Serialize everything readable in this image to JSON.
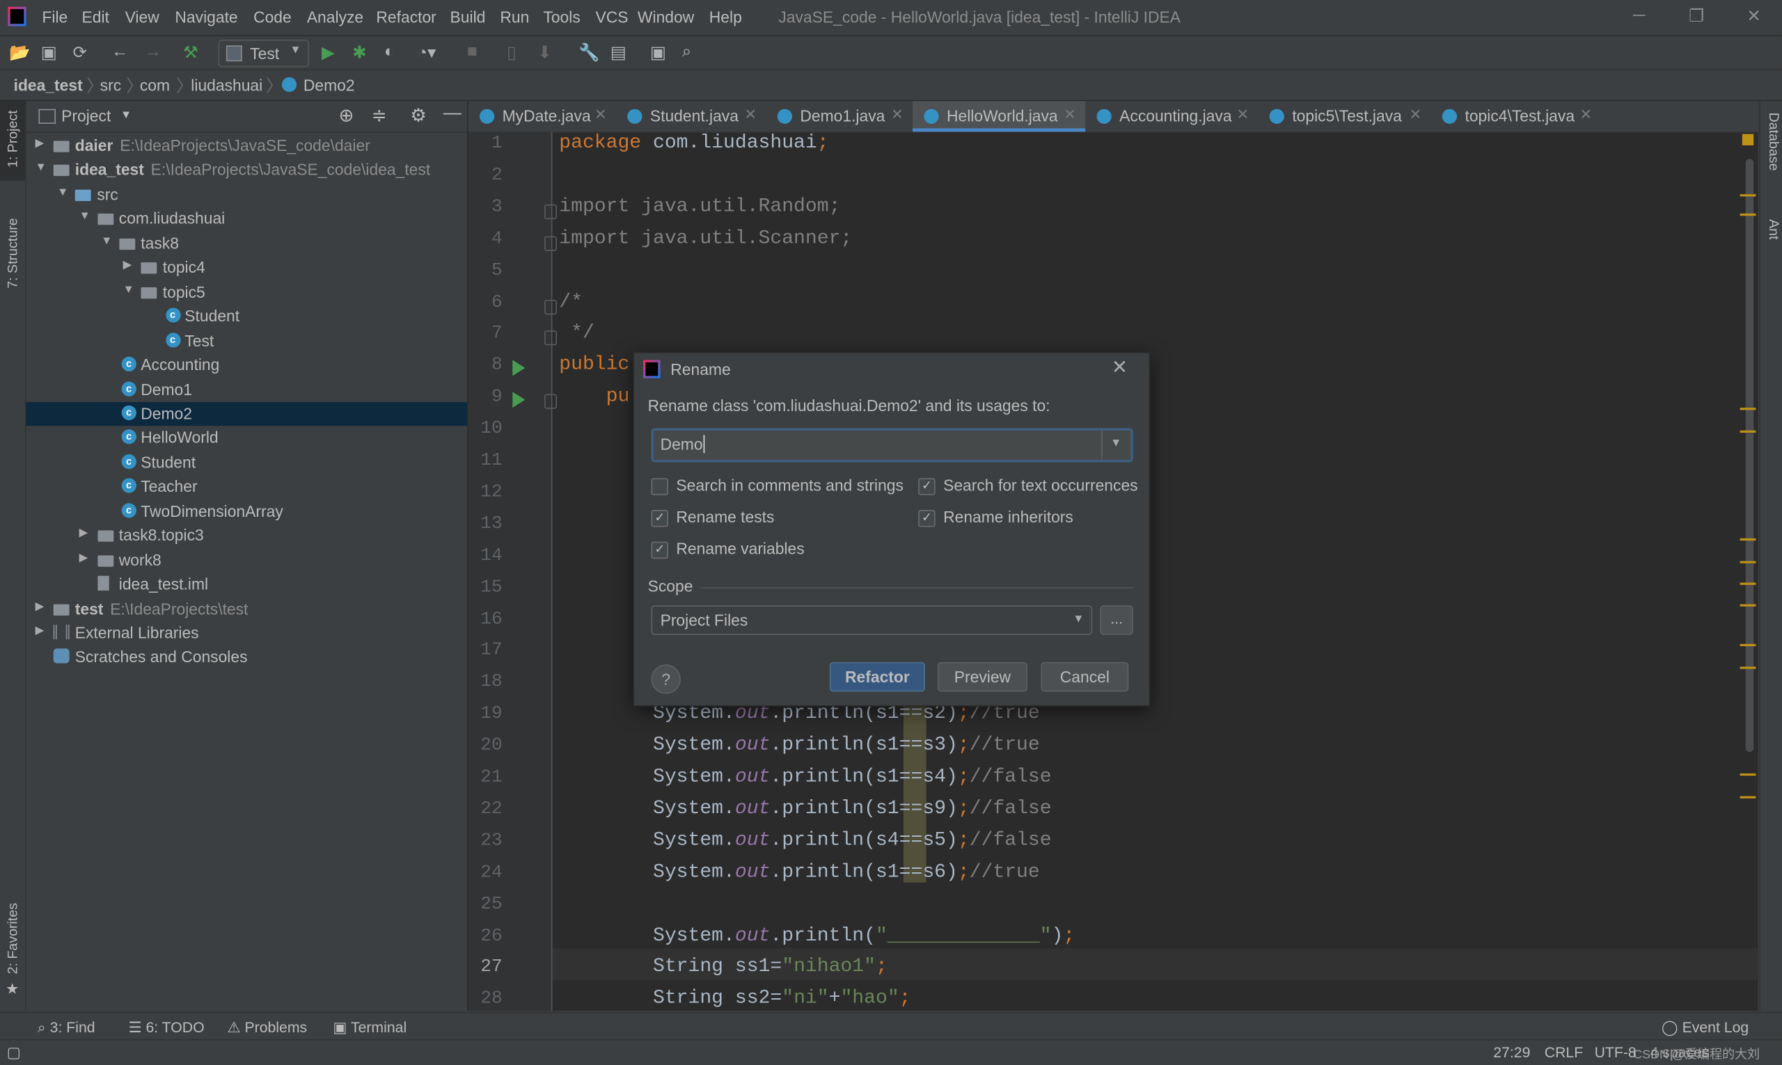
{
  "window": {
    "title": "JavaSE_code - HelloWorld.java [idea_test] - IntelliJ IDEA",
    "menu": [
      "File",
      "Edit",
      "View",
      "Navigate",
      "Code",
      "Analyze",
      "Refactor",
      "Build",
      "Run",
      "Tools",
      "VCS",
      "Window",
      "Help"
    ],
    "controls": {
      "minimize": "─",
      "restore": "❐",
      "close": "✕"
    }
  },
  "toolbar": {
    "run_config": "Test",
    "icons": [
      "open-folder-icon",
      "save-icon",
      "sync-icon",
      "back-icon",
      "forward-icon",
      "build-hammer-icon",
      "run-icon",
      "debug-icon",
      "coverage-icon",
      "profile-icon",
      "stop-icon",
      "device-icon",
      "deploy-icon",
      "settings-wrench-icon",
      "project-structure-icon",
      "run-window-icon",
      "search-icon"
    ]
  },
  "breadcrumb": [
    "idea_test",
    "src",
    "com",
    "liudashuai",
    "Demo2"
  ],
  "left_stripe": {
    "project": "1: Project",
    "structure": "7: Structure",
    "favorites": "2: Favorites"
  },
  "right_stripe": {
    "database": "Database",
    "ant": "Ant"
  },
  "project_panel": {
    "title": "Project",
    "tree": [
      {
        "label": "daier",
        "path": "E:\\IdeaProjects\\JavaSE_code\\daier",
        "level": 0,
        "type": "module",
        "expanded": false,
        "bold": true
      },
      {
        "label": "idea_test",
        "path": "E:\\IdeaProjects\\JavaSE_code\\idea_test",
        "level": 0,
        "type": "module",
        "expanded": true,
        "bold": true
      },
      {
        "label": "src",
        "level": 1,
        "type": "src",
        "expanded": true
      },
      {
        "label": "com.liudashuai",
        "level": 2,
        "type": "package",
        "expanded": true
      },
      {
        "label": "task8",
        "level": 3,
        "type": "package",
        "expanded": true
      },
      {
        "label": "topic4",
        "level": 4,
        "type": "package",
        "expanded": false
      },
      {
        "label": "topic5",
        "level": 4,
        "type": "package",
        "expanded": true
      },
      {
        "label": "Student",
        "level": 5,
        "type": "class"
      },
      {
        "label": "Test",
        "level": 5,
        "type": "class"
      },
      {
        "label": "Accounting",
        "level": 3,
        "type": "class"
      },
      {
        "label": "Demo1",
        "level": 3,
        "type": "class"
      },
      {
        "label": "Demo2",
        "level": 3,
        "type": "class",
        "selected": true
      },
      {
        "label": "HelloWorld",
        "level": 3,
        "type": "class"
      },
      {
        "label": "Student",
        "level": 3,
        "type": "class"
      },
      {
        "label": "Teacher",
        "level": 3,
        "type": "class"
      },
      {
        "label": "TwoDimensionArray",
        "level": 3,
        "type": "class"
      },
      {
        "label": "task8.topic3",
        "level": 2,
        "type": "package",
        "expanded": false
      },
      {
        "label": "work8",
        "level": 2,
        "type": "package",
        "expanded": false
      },
      {
        "label": "idea_test.iml",
        "level": 2,
        "type": "file"
      },
      {
        "label": "test",
        "path": "E:\\IdeaProjects\\test",
        "level": 0,
        "type": "module",
        "expanded": false,
        "bold": true
      },
      {
        "label": "External Libraries",
        "level": 0,
        "type": "libs",
        "expanded": false
      },
      {
        "label": "Scratches and Consoles",
        "level": 0,
        "type": "scratch"
      }
    ]
  },
  "tabs": [
    {
      "label": "MyDate.java"
    },
    {
      "label": "Student.java"
    },
    {
      "label": "Demo1.java"
    },
    {
      "label": "HelloWorld.java",
      "active": true
    },
    {
      "label": "Accounting.java"
    },
    {
      "label": "topic5\\Test.java"
    },
    {
      "label": "topic4\\Test.java"
    }
  ],
  "editor": {
    "current_line": 27,
    "lines": [
      {
        "n": 1,
        "tokens": [
          [
            "kw",
            "package "
          ],
          [
            "pl",
            "com.liudashuai"
          ],
          [
            "kw",
            ";"
          ]
        ]
      },
      {
        "n": 2,
        "tokens": []
      },
      {
        "n": 3,
        "tokens": [
          [
            "imp",
            "import java.util.Random;"
          ]
        ]
      },
      {
        "n": 4,
        "tokens": [
          [
            "imp",
            "import java.util.Scanner;"
          ]
        ]
      },
      {
        "n": 5,
        "tokens": []
      },
      {
        "n": 6,
        "tokens": [
          [
            "cm",
            "/*"
          ]
        ]
      },
      {
        "n": 7,
        "tokens": [
          [
            "cm",
            " */"
          ]
        ]
      },
      {
        "n": 8,
        "tokens": [
          [
            "kw",
            "public"
          ]
        ],
        "run": true
      },
      {
        "n": 9,
        "tokens": [
          [
            "kw",
            "    pu"
          ]
        ],
        "run": true
      },
      {
        "n": 10,
        "tokens": []
      },
      {
        "n": 11,
        "tokens": []
      },
      {
        "n": 12,
        "tokens": []
      },
      {
        "n": 13,
        "tokens": []
      },
      {
        "n": 14,
        "tokens": []
      },
      {
        "n": 15,
        "tokens": []
      },
      {
        "n": 16,
        "tokens": []
      },
      {
        "n": 17,
        "tokens": []
      },
      {
        "n": 18,
        "tokens": []
      },
      {
        "n": 19,
        "tokens": [
          [
            "pl",
            "        System."
          ],
          [
            "fd",
            "out"
          ],
          [
            "pl",
            ".println(s1==s2)"
          ],
          [
            "kw",
            ";"
          ],
          [
            "cm",
            "//true"
          ]
        ]
      },
      {
        "n": 20,
        "tokens": [
          [
            "pl",
            "        System."
          ],
          [
            "fd",
            "out"
          ],
          [
            "pl",
            ".println(s1==s3)"
          ],
          [
            "kw",
            ";"
          ],
          [
            "cm",
            "//true"
          ]
        ]
      },
      {
        "n": 21,
        "tokens": [
          [
            "pl",
            "        System."
          ],
          [
            "fd",
            "out"
          ],
          [
            "pl",
            ".println(s1==s4)"
          ],
          [
            "kw",
            ";"
          ],
          [
            "cm",
            "//false"
          ]
        ]
      },
      {
        "n": 22,
        "tokens": [
          [
            "pl",
            "        System."
          ],
          [
            "fd",
            "out"
          ],
          [
            "pl",
            ".println(s1==s9)"
          ],
          [
            "kw",
            ";"
          ],
          [
            "cm",
            "//false"
          ]
        ]
      },
      {
        "n": 23,
        "tokens": [
          [
            "pl",
            "        System."
          ],
          [
            "fd",
            "out"
          ],
          [
            "pl",
            ".println(s4==s5)"
          ],
          [
            "kw",
            ";"
          ],
          [
            "cm",
            "//false"
          ]
        ]
      },
      {
        "n": 24,
        "tokens": [
          [
            "pl",
            "        System."
          ],
          [
            "fd",
            "out"
          ],
          [
            "pl",
            ".println(s1==s6)"
          ],
          [
            "kw",
            ";"
          ],
          [
            "cm",
            "//true"
          ]
        ]
      },
      {
        "n": 25,
        "tokens": []
      },
      {
        "n": 26,
        "tokens": [
          [
            "pl",
            "        System."
          ],
          [
            "fd",
            "out"
          ],
          [
            "pl",
            ".println("
          ],
          [
            "st",
            "\"_____________\""
          ],
          [
            "pl",
            ")"
          ],
          [
            "kw",
            ";"
          ]
        ]
      },
      {
        "n": 27,
        "tokens": [
          [
            "pl",
            "        String ss1="
          ],
          [
            "st",
            "\"nihao1\""
          ],
          [
            "kw",
            ";"
          ]
        ]
      },
      {
        "n": 28,
        "tokens": [
          [
            "pl",
            "        String ss2="
          ],
          [
            "st",
            "\"ni\""
          ],
          [
            "pl",
            "+"
          ],
          [
            "st",
            "\"hao\""
          ],
          [
            "kw",
            ";"
          ]
        ]
      }
    ]
  },
  "rename_dialog": {
    "title": "Rename",
    "prompt": "Rename class 'com.liudashuai.Demo2' and its usages to:",
    "new_name": "Demo",
    "options": [
      {
        "label": "Search in comments and strings",
        "checked": false
      },
      {
        "label": "Search for text occurrences",
        "checked": true
      },
      {
        "label": "Rename tests",
        "checked": true
      },
      {
        "label": "Rename inheritors",
        "checked": true
      },
      {
        "label": "Rename variables",
        "checked": true
      }
    ],
    "scope_label": "Scope",
    "scope_value": "Project Files",
    "browse_label": "...",
    "help_label": "?",
    "buttons": {
      "refactor": "Refactor",
      "preview": "Preview",
      "cancel": "Cancel"
    }
  },
  "bottom_tools": {
    "find": "3: Find",
    "todo": "6: TODO",
    "problems": "Problems",
    "terminal": "Terminal",
    "event_log": "Event Log"
  },
  "status": {
    "position": "27:29",
    "line_sep": "CRLF",
    "encoding": "UTF-8",
    "indent": "4 spaces",
    "watermark": "CSDN @爱编程的大刘"
  },
  "colors": {
    "accent": "#4a88c7",
    "keyword": "#cc7832",
    "string": "#6a8759",
    "comment": "#808080",
    "field": "#9876aa",
    "selection": "#0d293e",
    "run": "#499c54"
  }
}
